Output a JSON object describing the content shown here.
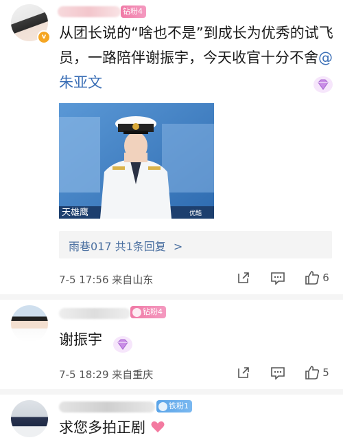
{
  "comment1": {
    "fan_badge": "钻粉4",
    "text": "从团长说的“啥也不是”到成长为优秀的试飞员，一路陪伴谢振宇，今天收官十分不舍",
    "mention": "@朱亚文",
    "photo_caption_left": "天雄鹰",
    "photo_watermark": "优酷",
    "reply_summary": "雨巷017  共1条回复",
    "reply_chevron": ">",
    "date_location": "7-5 17:56  来自山东",
    "likes": "6"
  },
  "comment2": {
    "fan_badge": "钻粉4",
    "text": "谢振宇",
    "date_location": "7-5 18:29  来自重庆",
    "likes": "5"
  },
  "comment3": {
    "fan_badge": "铁粉1",
    "text": "求您多拍正剧"
  },
  "icons": [
    "verified-badge-icon",
    "diamond-gem-icon",
    "share-icon",
    "reply-comment-icon",
    "thumbs-up-icon",
    "heart-icon"
  ],
  "colors": {
    "mention": "#3b6fb6",
    "fan_pink": "#f07aa6",
    "fan_blue": "#5aa4e8",
    "verified": "#f5a623"
  }
}
